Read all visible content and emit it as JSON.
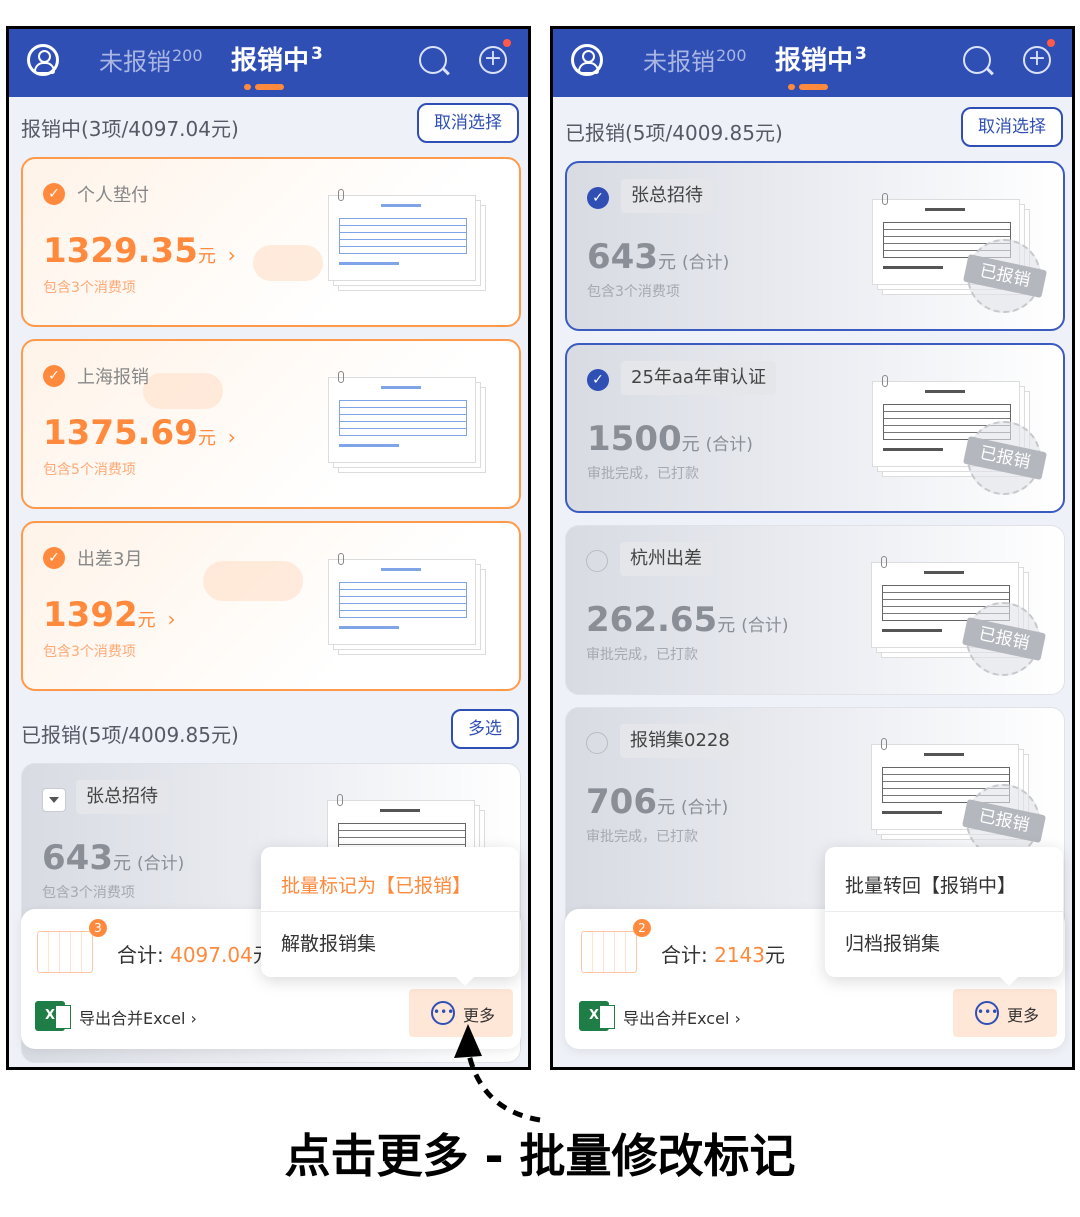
{
  "caption": "点击更多 - 批量修改标记",
  "left": {
    "nav": {
      "tab1": "未报销",
      "tab1_count": "200",
      "tab2": "报销中",
      "tab2_count": "3"
    },
    "section1": {
      "title": "报销中(3项/4097.04元)",
      "button": "取消选择"
    },
    "cards": [
      {
        "title": "个人垫付",
        "amount": "1329.35",
        "unit": "元",
        "arrow": "›",
        "sub": "包含3个消费项"
      },
      {
        "title": "上海报销",
        "amount": "1375.69",
        "unit": "元",
        "arrow": "›",
        "sub": "包含5个消费项"
      },
      {
        "title": "出差3月",
        "amount": "1392",
        "unit": "元",
        "arrow": "›",
        "sub": "包含3个消费项"
      }
    ],
    "section2": {
      "title": "已报销(5项/4009.85元)",
      "button": "多选"
    },
    "partial_card": {
      "title": "张总招待",
      "amount": "643",
      "unit": "元",
      "sum": "(合计)",
      "sub": "包含3个消费项"
    },
    "bottom": {
      "badge": "3",
      "total_label": "合计: ",
      "total_value": "4097.04",
      "total_unit": "元",
      "export": "导出合并Excel ›",
      "more": "更多"
    },
    "popup": {
      "item1": "批量标记为【已报销】",
      "item2": "解散报销集"
    }
  },
  "right": {
    "nav": {
      "tab1": "未报销",
      "tab1_count": "200",
      "tab2": "报销中",
      "tab2_count": "3"
    },
    "section1": {
      "title": "已报销(5项/4009.85元)",
      "button": "取消选择"
    },
    "cards": [
      {
        "title": "张总招待",
        "amount": "643",
        "unit": "元",
        "sum": "(合计)",
        "sub": "包含3个消费项",
        "stamp": "已报销"
      },
      {
        "title": "25年aa年审认证",
        "amount": "1500",
        "unit": "元",
        "sum": "(合计)",
        "sub": "审批完成，已打款",
        "stamp": "已报销"
      },
      {
        "title": "杭州出差",
        "amount": "262.65",
        "unit": "元",
        "sum": "(合计)",
        "sub": "审批完成，已打款",
        "stamp": "已报销"
      },
      {
        "title": "报销集0228",
        "amount": "706",
        "unit": "元",
        "sum": "(合计)",
        "sub": "审批完成，已打款",
        "stamp": "已报销"
      }
    ],
    "bottom": {
      "badge": "2",
      "total_label": "合计: ",
      "total_value": "2143",
      "total_unit": "元",
      "export": "导出合并Excel ›",
      "more": "更多"
    },
    "popup": {
      "item1": "批量转回【报销中】",
      "item2": "归档报销集"
    }
  },
  "colors": {
    "brand_blue": "#2f4fb5",
    "accent_orange": "#ff8a3d"
  },
  "icons": {
    "user": "user-circle-icon",
    "search": "search-icon",
    "add": "add-circle-icon",
    "excel": "excel-icon",
    "more": "more-dots-icon",
    "check": "check-circle-icon"
  }
}
